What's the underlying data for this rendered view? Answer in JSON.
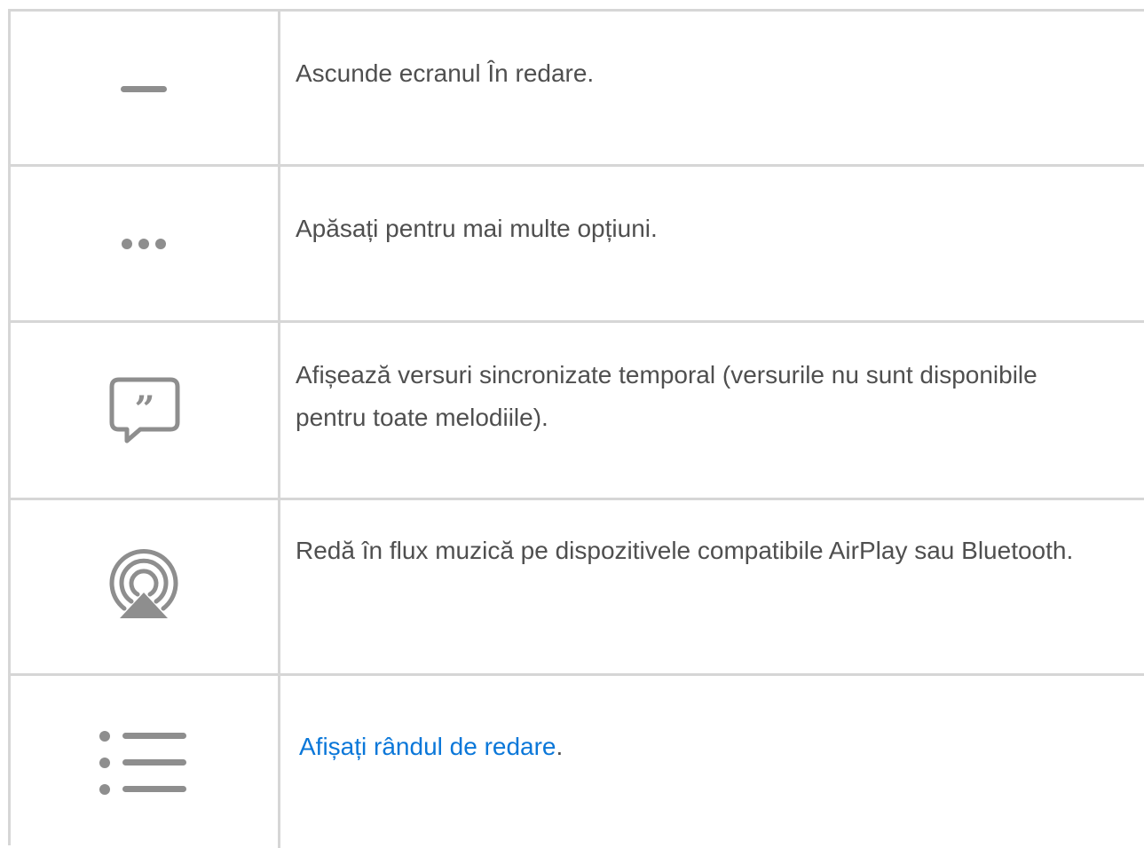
{
  "rows": [
    {
      "icon": "minimize-dash-icon",
      "text": "Ascunde ecranul În redare."
    },
    {
      "icon": "more-options-ellipsis-icon",
      "text": "Apăsați pentru mai multe opțiuni."
    },
    {
      "icon": "lyrics-quote-bubble-icon",
      "text": "Afișează versuri sincronizate temporal (versurile nu sunt disponibile pentru toate melodiile)."
    },
    {
      "icon": "airplay-audio-icon",
      "text": "Redă în flux muzică pe dispozitivele compatibile AirPlay sau Bluetooth."
    },
    {
      "icon": "playing-next-list-icon",
      "link_text": "Afișați rândul de redare",
      "suffix": "."
    }
  ],
  "colors": {
    "text": "#4f4f4f",
    "icon": "#8e8e8e",
    "border": "#d6d6d6",
    "link": "#0a77d9"
  }
}
